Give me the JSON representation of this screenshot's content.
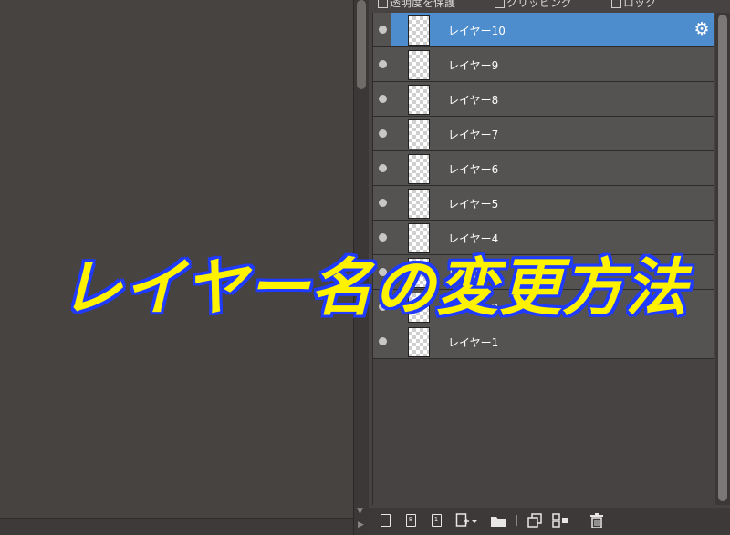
{
  "options": {
    "protect_opacity": "透明度を保護",
    "clipping": "クリッピング",
    "lock": "ロック"
  },
  "layers": [
    {
      "name": "レイヤー10",
      "selected": true
    },
    {
      "name": "レイヤー9",
      "selected": false
    },
    {
      "name": "レイヤー8",
      "selected": false
    },
    {
      "name": "レイヤー7",
      "selected": false
    },
    {
      "name": "レイヤー6",
      "selected": false
    },
    {
      "name": "レイヤー5",
      "selected": false
    },
    {
      "name": "レイヤー4",
      "selected": false
    },
    {
      "name": "レイヤー3",
      "selected": false
    },
    {
      "name": "レイヤー2",
      "selected": false
    },
    {
      "name": "レイヤー1",
      "selected": false
    }
  ],
  "overlay": {
    "title": "レイヤー名の変更方法"
  },
  "colors": {
    "selected_row": "#4d8dcd",
    "overlay_fill": "#fff200",
    "overlay_stroke": "#1f3bff"
  },
  "icons": {
    "layer_settings": "gear-icon",
    "toolbar": [
      "new-layer-icon",
      "new-8bit-layer-icon",
      "new-1bit-layer-icon",
      "add-layer-menu-icon",
      "new-folder-icon",
      "duplicate-layer-icon",
      "merge-layer-icon",
      "delete-layer-icon"
    ]
  }
}
